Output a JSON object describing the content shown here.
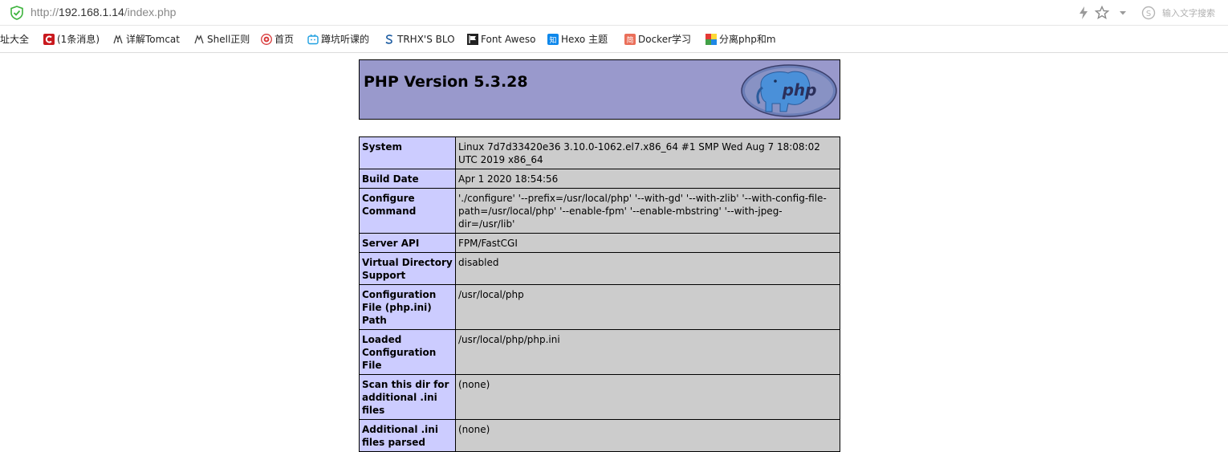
{
  "browser": {
    "url_scheme": "http://",
    "url_host": "192.168.1.14",
    "url_path": "/index.php",
    "search_placeholder": "输入文字搜索"
  },
  "bookmarks": [
    {
      "label": "址大全",
      "icon": "none"
    },
    {
      "label": "(1条消息)",
      "icon": "csdn-icon"
    },
    {
      "label": "详解Tomcat",
      "icon": "tomcat-icon"
    },
    {
      "label": "Shell正则",
      "icon": "shell-icon"
    },
    {
      "label": "首页",
      "icon": "home-red-icon"
    },
    {
      "label": "蹲坑听课的",
      "icon": "bilibili-icon"
    },
    {
      "label": "TRHX'S BLO",
      "icon": "trhx-icon"
    },
    {
      "label": "Font Aweso",
      "icon": "flag-icon"
    },
    {
      "label": "Hexo 主题",
      "icon": "zhihu-icon"
    },
    {
      "label": "Docker学习",
      "icon": "jianshu-icon"
    },
    {
      "label": "分离php和m",
      "icon": "colorful-icon"
    }
  ],
  "phpinfo": {
    "title": "PHP Version 5.3.28",
    "rows": [
      {
        "key": "System",
        "value": "Linux 7d7d33420e36 3.10.0-1062.el7.x86_64 #1 SMP Wed Aug 7 18:08:02 UTC 2019 x86_64"
      },
      {
        "key": "Build Date",
        "value": "Apr 1 2020 18:54:56"
      },
      {
        "key": "Configure Command",
        "value": "'./configure' '--prefix=/usr/local/php' '--with-gd' '--with-zlib' '--with-config-file-path=/usr/local/php' '--enable-fpm' '--enable-mbstring' '--with-jpeg-dir=/usr/lib'"
      },
      {
        "key": "Server API",
        "value": "FPM/FastCGI"
      },
      {
        "key": "Virtual Directory Support",
        "value": "disabled"
      },
      {
        "key": "Configuration File (php.ini) Path",
        "value": "/usr/local/php"
      },
      {
        "key": "Loaded Configuration File",
        "value": "/usr/local/php/php.ini"
      },
      {
        "key": "Scan this dir for additional .ini files",
        "value": "(none)"
      },
      {
        "key": "Additional .ini files parsed",
        "value": "(none)"
      }
    ]
  }
}
